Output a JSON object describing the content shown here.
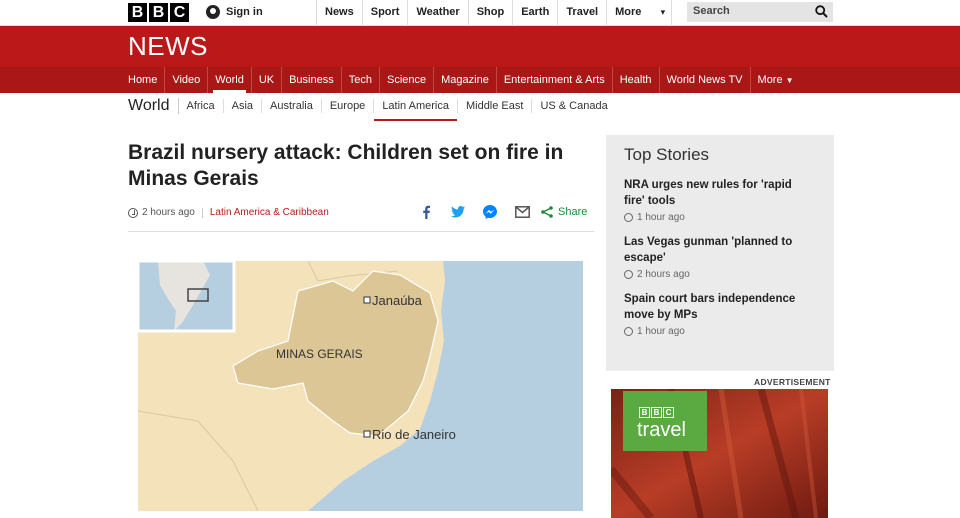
{
  "top_bar": {
    "brand_letters": [
      "B",
      "B",
      "C"
    ],
    "sign_in": "Sign in",
    "nav": [
      "News",
      "Sport",
      "Weather",
      "Shop",
      "Earth",
      "Travel",
      "More"
    ],
    "search_placeholder": "Search"
  },
  "banner": {
    "title": "NEWS"
  },
  "main_nav": {
    "items": [
      "Home",
      "Video",
      "World",
      "UK",
      "Business",
      "Tech",
      "Science",
      "Magazine",
      "Entertainment & Arts",
      "Health",
      "World News TV",
      "More"
    ],
    "active": "World"
  },
  "section_nav": {
    "title": "World",
    "items": [
      "Africa",
      "Asia",
      "Australia",
      "Europe",
      "Latin America",
      "Middle East",
      "US & Canada"
    ],
    "active": "Latin America"
  },
  "article": {
    "headline": "Brazil nursery attack: Children set on fire in Minas Gerais",
    "time": "2 hours ago",
    "category": "Latin America & Caribbean",
    "share_label": "Share",
    "map_labels": {
      "region": "MINAS GERAIS",
      "city1": "Janaúba",
      "city2": "Rio de Janeiro"
    }
  },
  "top_stories": {
    "heading": "Top Stories",
    "items": [
      {
        "title": "NRA urges new rules for 'rapid fire' tools",
        "time": "1 hour ago"
      },
      {
        "title": "Las Vegas gunman 'planned to escape'",
        "time": "2 hours ago"
      },
      {
        "title": "Spain court bars independence move by MPs",
        "time": "1 hour ago"
      }
    ]
  },
  "advertisement": {
    "label": "ADVERTISEMENT",
    "logo_letters": [
      "B",
      "B",
      "C"
    ],
    "logo_text": "travel"
  },
  "colors": {
    "brand_red": "#bb1919",
    "nav_red": "#a91717",
    "share_green": "#1d8b3a",
    "ad_green": "#5aaa41"
  }
}
